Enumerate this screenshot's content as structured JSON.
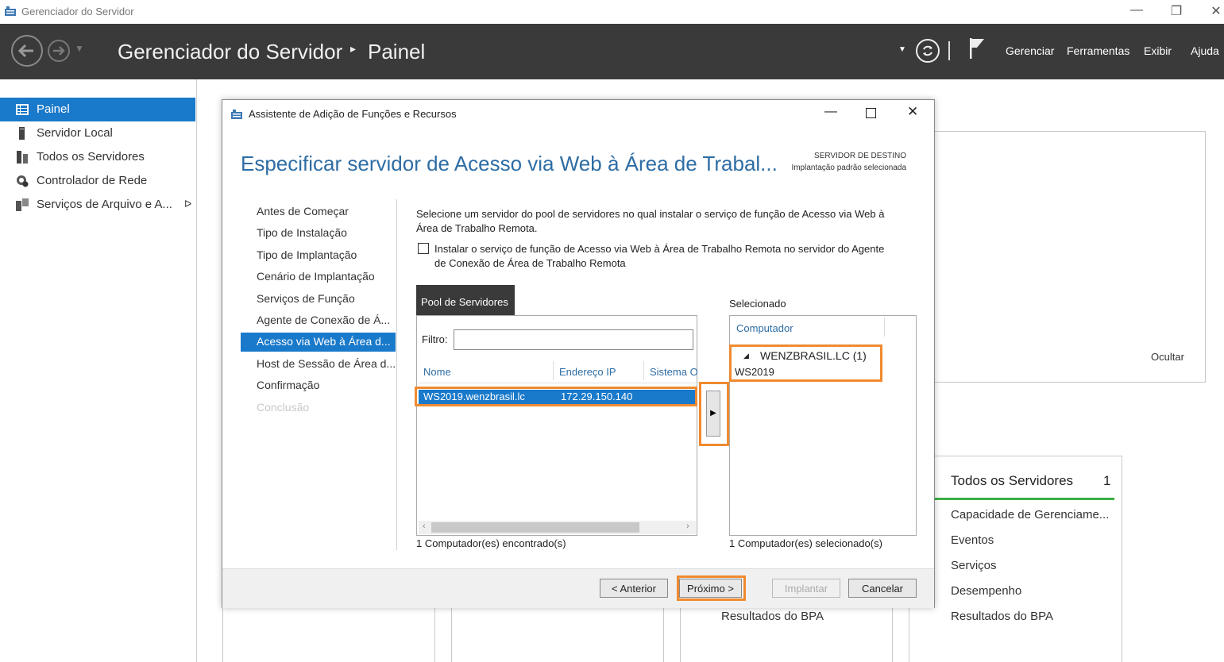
{
  "window": {
    "title": "Gerenciador do Servidor",
    "controls": [
      "minimize-icon",
      "restore-icon",
      "close-icon"
    ]
  },
  "header": {
    "app_title": "Gerenciador do Servidor",
    "separator": "▸",
    "page": "Painel",
    "menu": [
      "Gerenciar",
      "Ferramentas",
      "Exibir",
      "Ajuda"
    ]
  },
  "sidebar": {
    "items": [
      {
        "label": "Painel",
        "icon": "dashboard-icon",
        "active": true
      },
      {
        "label": "Servidor Local",
        "icon": "server-icon"
      },
      {
        "label": "Todos os Servidores",
        "icon": "servers-icon"
      },
      {
        "label": "Controlador de Rede",
        "icon": "network-controller-icon"
      },
      {
        "label": "Serviços de Arquivo e A...",
        "icon": "file-services-icon"
      }
    ],
    "expand_arrow": "ᐅ"
  },
  "background": {
    "hide_label": "Ocultar",
    "tile": {
      "title": "Todos os Servidores",
      "count": "1",
      "items": [
        "Capacidade de Gerenciame...",
        "Eventos",
        "Serviços",
        "Desempenho",
        "Resultados do BPA"
      ]
    },
    "bpa_left": "Resultados do BPA"
  },
  "dialog": {
    "title": "Assistente de Adição de Funções e Recursos",
    "heading": "Especificar servidor de Acesso via Web à Área de Trabal...",
    "dest_heading": "SERVIDOR DE DESTINO",
    "dest_sub": "Implantação padrão selecionada",
    "nav": [
      {
        "label": "Antes de Começar",
        "state": "normal"
      },
      {
        "label": "Tipo de Instalação",
        "state": "normal"
      },
      {
        "label": "Tipo de Implantação",
        "state": "normal"
      },
      {
        "label": "Cenário de Implantação",
        "state": "normal"
      },
      {
        "label": "Serviços de Função",
        "state": "normal"
      },
      {
        "label": "Agente de Conexão de Á...",
        "state": "normal"
      },
      {
        "label": "Acesso via Web à Área d...",
        "state": "active"
      },
      {
        "label": "Host de Sessão de Área d...",
        "state": "normal"
      },
      {
        "label": "Confirmação",
        "state": "normal"
      },
      {
        "label": "Conclusão",
        "state": "disabled"
      }
    ],
    "description_line1": "Selecione um servidor do pool de servidores no qual instalar o serviço de função de Acesso via Web à",
    "description_line2": "Área de Trabalho Remota.",
    "checkbox_line1": "Instalar o serviço de função de Acesso via Web à Área de Trabalho Remota no servidor do Agente",
    "checkbox_line2": "de Conexão de Área de Trabalho Remota",
    "checkbox_checked": false,
    "pool": {
      "tab": "Pool de Servidores",
      "filter_label": "Filtro:",
      "filter_value": "",
      "columns": [
        "Nome",
        "Endereço IP",
        "Sistema O"
      ],
      "rows": [
        {
          "name": "WS2019.wenzbrasil.lc",
          "ip": "172.29.150.140",
          "os": ""
        }
      ],
      "count_text": "1 Computador(es) encontrado(s)"
    },
    "add_button": "▶",
    "selected": {
      "label": "Selecionado",
      "column": "Computador",
      "group": "WENZBRASIL.LC (1)",
      "group_toggle": "◢",
      "items": [
        "WS2019"
      ],
      "count_text": "1 Computador(es) selecionado(s)"
    },
    "buttons": {
      "previous": "< Anterior",
      "next": "Próximo >",
      "install": "Implantar",
      "cancel": "Cancelar"
    },
    "highlight_color": "#f08a30",
    "accent_color": "#1979ca"
  }
}
